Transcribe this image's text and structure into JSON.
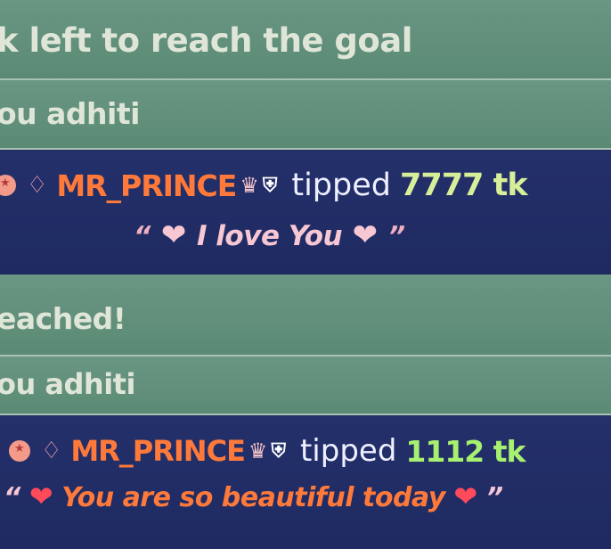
{
  "chat": {
    "messages": [
      {
        "kind": "system",
        "text": "k left to reach the goal"
      },
      {
        "kind": "system",
        "text": "ou adhiti"
      },
      {
        "kind": "tip",
        "username": "MR_PRINCE",
        "action": "tipped",
        "amount": "7777 tk",
        "message": "I love You",
        "open_quote": "“",
        "close_quote": "”",
        "icons": [
          "rank-badge-icon",
          "gem-icon",
          "crown-icon",
          "shield-icon",
          "heart-icon"
        ]
      },
      {
        "kind": "system",
        "text": "eached!"
      },
      {
        "kind": "system",
        "text": "ou adhiti"
      },
      {
        "kind": "tip",
        "username": "MR_PRINCE",
        "action": "tipped",
        "amount": "1112 tk",
        "message": "You are so beautiful today",
        "open_quote": "“",
        "close_quote": "”",
        "icons": [
          "rank-badge-icon",
          "gem-icon",
          "crown-icon",
          "shield-icon",
          "heart-icon"
        ]
      }
    ]
  },
  "colors": {
    "system_bg": "#5f8c79",
    "tip_bg": "#23306a",
    "username": "#ff7a3a",
    "amount_1": "#d8ef9a",
    "amount_2": "#a8f070",
    "message_1": "#f7c7d3",
    "message_2": "#ff7a3a",
    "heart_1": "#f7c7d3",
    "heart_2": "#ff4a5a"
  }
}
